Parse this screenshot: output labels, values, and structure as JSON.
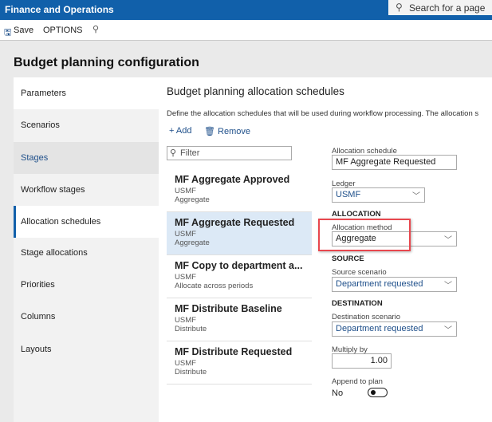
{
  "app": {
    "title": "Finance and Operations",
    "search_placeholder": "Search for a page"
  },
  "toolbar": {
    "save_label": "Save",
    "options_label": "OPTIONS"
  },
  "page": {
    "title": "Budget planning configuration"
  },
  "nav": {
    "items": [
      {
        "label": "Parameters"
      },
      {
        "label": "Scenarios"
      },
      {
        "label": "Stages"
      },
      {
        "label": "Workflow stages"
      },
      {
        "label": "Allocation schedules",
        "selected": true
      },
      {
        "label": "Stage allocations"
      },
      {
        "label": "Priorities"
      },
      {
        "label": "Columns"
      },
      {
        "label": "Layouts"
      }
    ]
  },
  "main": {
    "title": "Budget planning allocation schedules",
    "description": "Define the allocation schedules that will be used during workflow processing. The allocation s",
    "add_label": "Add",
    "remove_label": "Remove",
    "filter_placeholder": "Filter",
    "list": [
      {
        "title": "MF Aggregate Approved",
        "ledger": "USMF",
        "method": "Aggregate"
      },
      {
        "title": "MF Aggregate Requested",
        "ledger": "USMF",
        "method": "Aggregate",
        "selected": true
      },
      {
        "title": "MF Copy to department a...",
        "ledger": "USMF",
        "method": "Allocate across periods"
      },
      {
        "title": "MF Distribute Baseline",
        "ledger": "USMF",
        "method": "Distribute"
      },
      {
        "title": "MF Distribute Requested",
        "ledger": "USMF",
        "method": "Distribute"
      }
    ],
    "form": {
      "schedule_label": "Allocation schedule",
      "schedule_value": "MF Aggregate Requested",
      "ledger_label": "Ledger",
      "ledger_value": "USMF",
      "allocation_header": "ALLOCATION",
      "method_label": "Allocation method",
      "method_value": "Aggregate",
      "source_header": "SOURCE",
      "source_label": "Source scenario",
      "source_value": "Department requested",
      "destination_header": "DESTINATION",
      "destination_label": "Destination scenario",
      "destination_value": "Department requested",
      "multiply_label": "Multiply by",
      "multiply_value": "1.00",
      "append_label": "Append to plan",
      "append_value": "No"
    }
  },
  "colors": {
    "brand": "#1160aa",
    "highlight": "#e8474e",
    "selected_row": "#dce9f6"
  }
}
